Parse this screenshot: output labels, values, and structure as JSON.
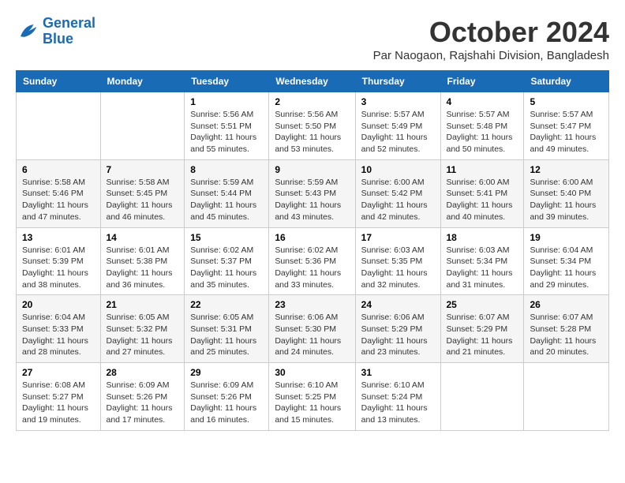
{
  "header": {
    "logo_line1": "General",
    "logo_line2": "Blue",
    "month": "October 2024",
    "location": "Par Naogaon, Rajshahi Division, Bangladesh"
  },
  "days_of_week": [
    "Sunday",
    "Monday",
    "Tuesday",
    "Wednesday",
    "Thursday",
    "Friday",
    "Saturday"
  ],
  "weeks": [
    [
      {
        "day": "",
        "info": ""
      },
      {
        "day": "",
        "info": ""
      },
      {
        "day": "1",
        "info": "Sunrise: 5:56 AM\nSunset: 5:51 PM\nDaylight: 11 hours and 55 minutes."
      },
      {
        "day": "2",
        "info": "Sunrise: 5:56 AM\nSunset: 5:50 PM\nDaylight: 11 hours and 53 minutes."
      },
      {
        "day": "3",
        "info": "Sunrise: 5:57 AM\nSunset: 5:49 PM\nDaylight: 11 hours and 52 minutes."
      },
      {
        "day": "4",
        "info": "Sunrise: 5:57 AM\nSunset: 5:48 PM\nDaylight: 11 hours and 50 minutes."
      },
      {
        "day": "5",
        "info": "Sunrise: 5:57 AM\nSunset: 5:47 PM\nDaylight: 11 hours and 49 minutes."
      }
    ],
    [
      {
        "day": "6",
        "info": "Sunrise: 5:58 AM\nSunset: 5:46 PM\nDaylight: 11 hours and 47 minutes."
      },
      {
        "day": "7",
        "info": "Sunrise: 5:58 AM\nSunset: 5:45 PM\nDaylight: 11 hours and 46 minutes."
      },
      {
        "day": "8",
        "info": "Sunrise: 5:59 AM\nSunset: 5:44 PM\nDaylight: 11 hours and 45 minutes."
      },
      {
        "day": "9",
        "info": "Sunrise: 5:59 AM\nSunset: 5:43 PM\nDaylight: 11 hours and 43 minutes."
      },
      {
        "day": "10",
        "info": "Sunrise: 6:00 AM\nSunset: 5:42 PM\nDaylight: 11 hours and 42 minutes."
      },
      {
        "day": "11",
        "info": "Sunrise: 6:00 AM\nSunset: 5:41 PM\nDaylight: 11 hours and 40 minutes."
      },
      {
        "day": "12",
        "info": "Sunrise: 6:00 AM\nSunset: 5:40 PM\nDaylight: 11 hours and 39 minutes."
      }
    ],
    [
      {
        "day": "13",
        "info": "Sunrise: 6:01 AM\nSunset: 5:39 PM\nDaylight: 11 hours and 38 minutes."
      },
      {
        "day": "14",
        "info": "Sunrise: 6:01 AM\nSunset: 5:38 PM\nDaylight: 11 hours and 36 minutes."
      },
      {
        "day": "15",
        "info": "Sunrise: 6:02 AM\nSunset: 5:37 PM\nDaylight: 11 hours and 35 minutes."
      },
      {
        "day": "16",
        "info": "Sunrise: 6:02 AM\nSunset: 5:36 PM\nDaylight: 11 hours and 33 minutes."
      },
      {
        "day": "17",
        "info": "Sunrise: 6:03 AM\nSunset: 5:35 PM\nDaylight: 11 hours and 32 minutes."
      },
      {
        "day": "18",
        "info": "Sunrise: 6:03 AM\nSunset: 5:34 PM\nDaylight: 11 hours and 31 minutes."
      },
      {
        "day": "19",
        "info": "Sunrise: 6:04 AM\nSunset: 5:34 PM\nDaylight: 11 hours and 29 minutes."
      }
    ],
    [
      {
        "day": "20",
        "info": "Sunrise: 6:04 AM\nSunset: 5:33 PM\nDaylight: 11 hours and 28 minutes."
      },
      {
        "day": "21",
        "info": "Sunrise: 6:05 AM\nSunset: 5:32 PM\nDaylight: 11 hours and 27 minutes."
      },
      {
        "day": "22",
        "info": "Sunrise: 6:05 AM\nSunset: 5:31 PM\nDaylight: 11 hours and 25 minutes."
      },
      {
        "day": "23",
        "info": "Sunrise: 6:06 AM\nSunset: 5:30 PM\nDaylight: 11 hours and 24 minutes."
      },
      {
        "day": "24",
        "info": "Sunrise: 6:06 AM\nSunset: 5:29 PM\nDaylight: 11 hours and 23 minutes."
      },
      {
        "day": "25",
        "info": "Sunrise: 6:07 AM\nSunset: 5:29 PM\nDaylight: 11 hours and 21 minutes."
      },
      {
        "day": "26",
        "info": "Sunrise: 6:07 AM\nSunset: 5:28 PM\nDaylight: 11 hours and 20 minutes."
      }
    ],
    [
      {
        "day": "27",
        "info": "Sunrise: 6:08 AM\nSunset: 5:27 PM\nDaylight: 11 hours and 19 minutes."
      },
      {
        "day": "28",
        "info": "Sunrise: 6:09 AM\nSunset: 5:26 PM\nDaylight: 11 hours and 17 minutes."
      },
      {
        "day": "29",
        "info": "Sunrise: 6:09 AM\nSunset: 5:26 PM\nDaylight: 11 hours and 16 minutes."
      },
      {
        "day": "30",
        "info": "Sunrise: 6:10 AM\nSunset: 5:25 PM\nDaylight: 11 hours and 15 minutes."
      },
      {
        "day": "31",
        "info": "Sunrise: 6:10 AM\nSunset: 5:24 PM\nDaylight: 11 hours and 13 minutes."
      },
      {
        "day": "",
        "info": ""
      },
      {
        "day": "",
        "info": ""
      }
    ]
  ]
}
